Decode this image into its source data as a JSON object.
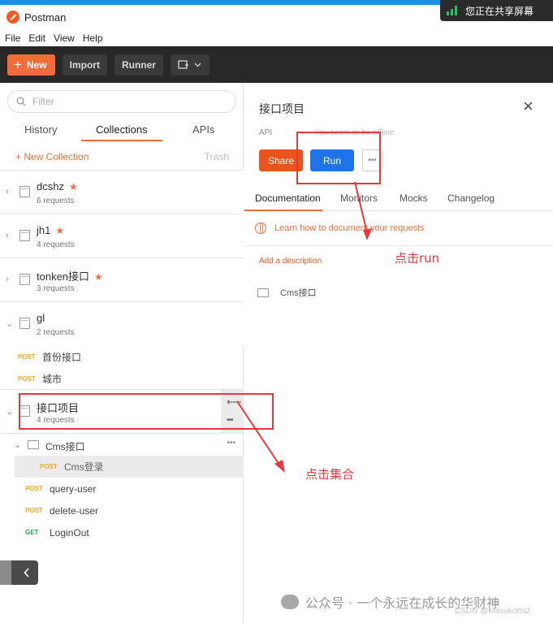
{
  "titlebar": {
    "title": "Postman"
  },
  "share_banner": {
    "text": "您正在共享屏幕",
    "accent": "#21c45f"
  },
  "menu": {
    "file": "File",
    "edit": "Edit",
    "view": "View",
    "help": "Help"
  },
  "toolbar": {
    "new_label": "New",
    "import_label": "Import",
    "runner_label": "Runner",
    "accent": "#f26b3a"
  },
  "sidebar": {
    "search_placeholder": "Filter",
    "tabs": {
      "history": "History",
      "collections": "Collections",
      "apis": "APIs"
    },
    "new_collection": "+ New Collection",
    "trash": "Trash",
    "collections": [
      {
        "name": "dcshz",
        "star": "★",
        "count": "6 requests"
      },
      {
        "name": "jh1",
        "star": "★",
        "count": "4 requests"
      },
      {
        "name": "tonken接口",
        "star": "★",
        "count": "3 requests"
      },
      {
        "name": "gl",
        "count": "2 requests"
      },
      {
        "name": "接口项目",
        "count": "4 requests"
      }
    ],
    "gl_requests": [
      {
        "method": "POST",
        "name": "首份接口"
      },
      {
        "method": "POST",
        "name": "城市"
      }
    ],
    "folder": {
      "name": "Cms接口"
    },
    "folder_requests": [
      {
        "method": "POST",
        "name": "Cms登录"
      },
      {
        "method": "POST",
        "name": "query-user"
      },
      {
        "method": "POST",
        "name": "delete-user"
      },
      {
        "method": "GET",
        "name": "LoginOut"
      }
    ]
  },
  "panel": {
    "title": "接口项目",
    "api_label": "API",
    "offline": "You seem to be offline.",
    "share": "Share",
    "run": "Run",
    "tabs": {
      "documentation": "Documentation",
      "monitors": "Monitors",
      "mocks": "Mocks",
      "changelog": "Changelog"
    },
    "learn": "Learn how to document your requests",
    "add_description": "Add a description",
    "folder_name": "Cms接口"
  },
  "annotations": {
    "click_run": "点击run",
    "click_collection": "点击集合",
    "color": "#e8383d"
  },
  "watermark": {
    "text": "公众号 · 一个永远在成长的华财神",
    "csdn": "CSDN @Masukotto2"
  }
}
